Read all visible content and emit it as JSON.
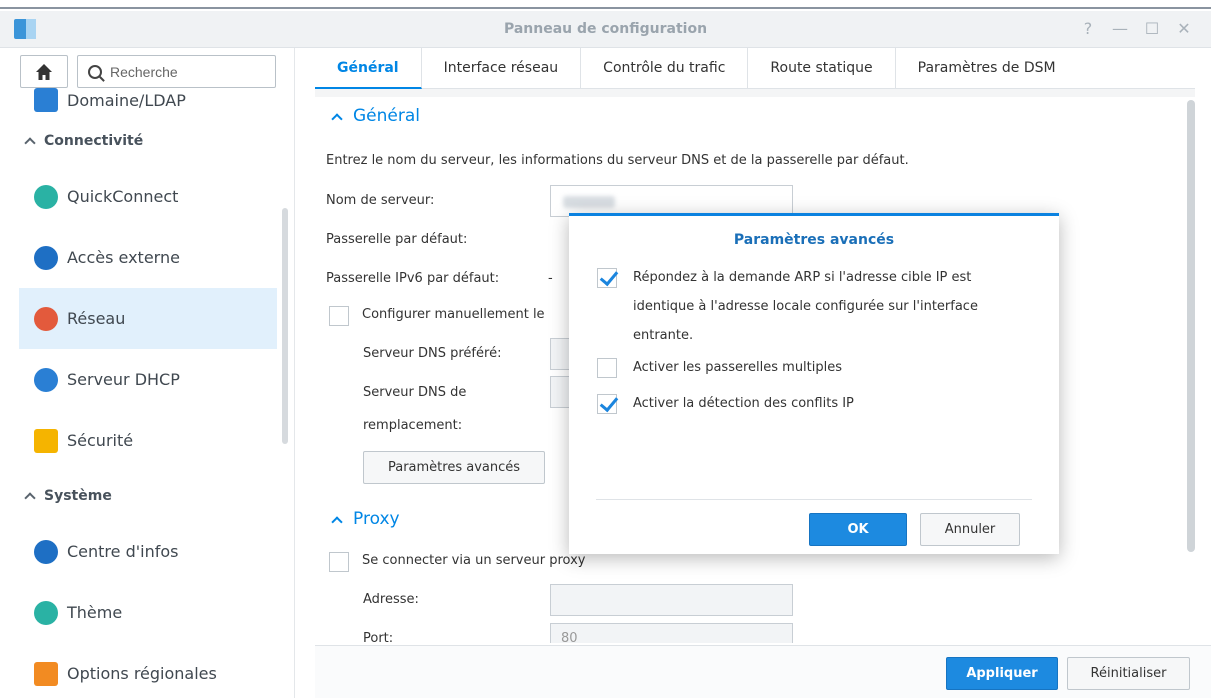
{
  "window": {
    "title": "Panneau de configuration",
    "controls": [
      "?",
      "—",
      "☐",
      "✕"
    ]
  },
  "sidebar": {
    "search_placeholder": "Recherche",
    "items": [
      {
        "type": "item",
        "label": "Domaine/LDAP",
        "icon": "domain-icon",
        "color": "#2a7fd4"
      },
      {
        "type": "section",
        "label": "Connectivité"
      },
      {
        "type": "item",
        "label": "QuickConnect",
        "icon": "quickconnect-icon",
        "color": "#2ab2a4"
      },
      {
        "type": "item",
        "label": "Accès externe",
        "icon": "globe-icon",
        "color": "#1e6fc4"
      },
      {
        "type": "item",
        "label": "Réseau",
        "icon": "house-icon",
        "color": "#e35a3c",
        "active": true
      },
      {
        "type": "item",
        "label": "Serveur DHCP",
        "icon": "dhcp-icon",
        "color": "#2a7fd4"
      },
      {
        "type": "item",
        "label": "Sécurité",
        "icon": "shield-icon",
        "color": "#f5b400"
      },
      {
        "type": "section",
        "label": "Système"
      },
      {
        "type": "item",
        "label": "Centre d'infos",
        "icon": "info-icon",
        "color": "#1e6fc4"
      },
      {
        "type": "item",
        "label": "Thème",
        "icon": "palette-icon",
        "color": "#2ab2a4"
      },
      {
        "type": "item",
        "label": "Options régionales",
        "icon": "regional-icon",
        "color": "#f28b22"
      }
    ]
  },
  "tabs": [
    "Général",
    "Interface réseau",
    "Contrôle du trafic",
    "Route statique",
    "Paramètres de DSM"
  ],
  "general": {
    "heading": "Général",
    "description": "Entrez le nom du serveur, les informations du serveur DNS et de la passerelle par défaut.",
    "server_name_label": "Nom de serveur:",
    "default_gateway_label": "Passerelle par défaut:",
    "ipv6_gateway_label": "Passerelle IPv6 par défaut:",
    "ipv6_gateway_value": "-",
    "manual_dns_label": "Configurer manuellement le",
    "preferred_dns_label": "Serveur DNS préféré:",
    "alt_dns_label_1": "Serveur DNS de",
    "alt_dns_label_2": "remplacement:",
    "advanced_button": "Paramètres avancés"
  },
  "proxy": {
    "heading": "Proxy",
    "connect_label": "Se connecter via un serveur proxy",
    "address_label": "Adresse:",
    "port_label": "Port:",
    "port_value": "80"
  },
  "footer": {
    "apply": "Appliquer",
    "reset": "Réinitialiser"
  },
  "dialog": {
    "title": "Paramètres avancés",
    "options": [
      {
        "checked": true,
        "lines": [
          "Répondez à la demande ARP si l'adresse cible IP est",
          "identique à l'adresse locale configurée sur l'interface",
          "entrante."
        ]
      },
      {
        "checked": false,
        "lines": [
          "Activer les passerelles multiples"
        ]
      },
      {
        "checked": true,
        "lines": [
          "Activer la détection des conflits IP"
        ]
      }
    ],
    "ok": "OK",
    "cancel": "Annuler"
  }
}
